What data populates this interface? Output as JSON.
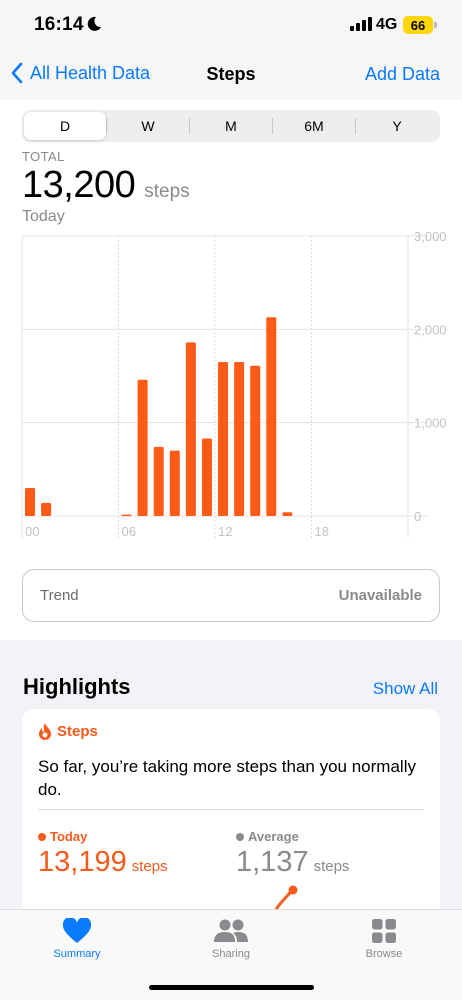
{
  "status": {
    "time": "16:14",
    "network": "4G",
    "battery": "66"
  },
  "nav": {
    "back_label": "All Health Data",
    "title": "Steps",
    "action_label": "Add Data"
  },
  "segments": [
    "D",
    "W",
    "M",
    "6M",
    "Y"
  ],
  "selected_segment": "D",
  "summary": {
    "label": "TOTAL",
    "value": "13,200",
    "unit": "steps",
    "date": "Today"
  },
  "chart_data": {
    "type": "bar",
    "x": [
      0,
      1,
      2,
      3,
      4,
      5,
      6,
      7,
      8,
      9,
      10,
      11,
      12,
      13,
      14,
      15,
      16,
      17,
      18,
      19,
      20,
      21,
      22,
      23
    ],
    "values": [
      300,
      140,
      0,
      0,
      0,
      0,
      15,
      1460,
      740,
      700,
      1860,
      830,
      1650,
      1650,
      1610,
      2130,
      40,
      0,
      0,
      0,
      0,
      0,
      0,
      0
    ],
    "x_tick_labels": [
      "00",
      "06",
      "12",
      "18"
    ],
    "y_tick_labels": [
      "0",
      "1,000",
      "2,000",
      "3,000"
    ],
    "ylim": [
      0,
      3000
    ],
    "bar_color": "#ff5a16",
    "grid": true
  },
  "trend": {
    "label": "Trend",
    "value": "Unavailable"
  },
  "highlights": {
    "title": "Highlights",
    "show_all": "Show All",
    "card": {
      "tag": "Steps",
      "text": "So far, you’re taking more steps than you normally do.",
      "today_label": "Today",
      "today_value": "13,199",
      "today_unit": "steps",
      "average_label": "Average",
      "average_value": "1,137",
      "average_unit": "steps"
    }
  },
  "tabs": [
    {
      "label": "Summary",
      "icon": "heart-icon",
      "active": true
    },
    {
      "label": "Sharing",
      "icon": "people-icon",
      "active": false
    },
    {
      "label": "Browse",
      "icon": "grid-icon",
      "active": false
    }
  ],
  "colors": {
    "accent": "#0a7aff",
    "steps": "#f45b1c",
    "inactive": "#8a8a8e"
  }
}
